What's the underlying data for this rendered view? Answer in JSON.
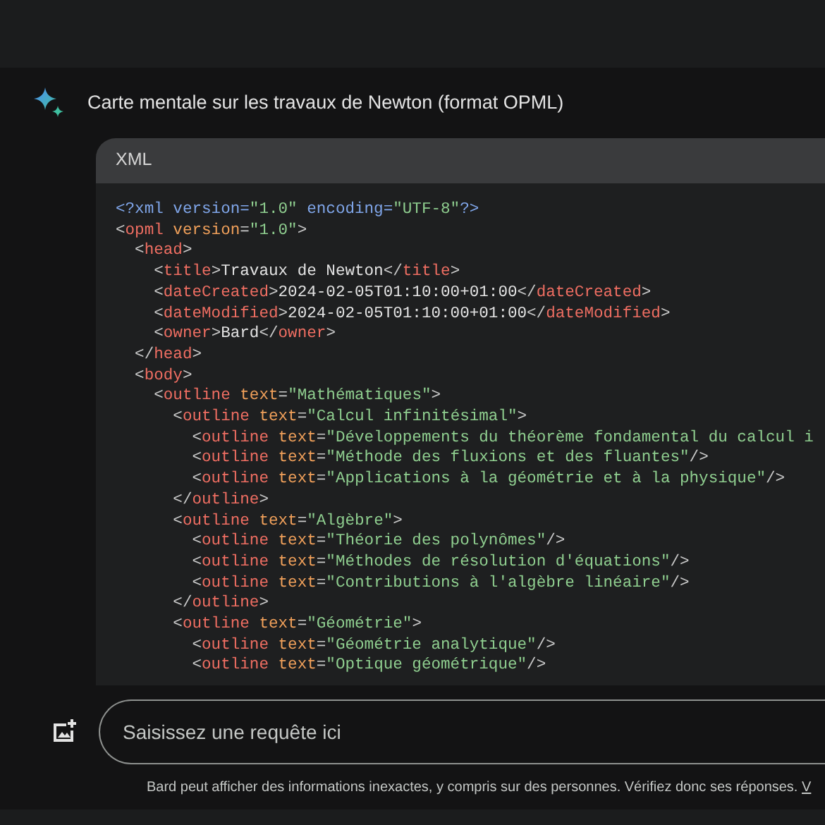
{
  "response": {
    "title": "Carte mentale sur les travaux de Newton (format OPML)",
    "code_block": {
      "language": "XML",
      "lines": [
        [
          {
            "kind": "decl",
            "text": "<?xml version="
          },
          {
            "kind": "string",
            "text": "\"1.0\""
          },
          {
            "kind": "decl",
            "text": " encoding="
          },
          {
            "kind": "string",
            "text": "\"UTF-8\""
          },
          {
            "kind": "decl",
            "text": "?>"
          }
        ],
        [
          {
            "kind": "punct",
            "text": "<"
          },
          {
            "kind": "tag",
            "text": "opml"
          },
          {
            "kind": "attr",
            "text": " version"
          },
          {
            "kind": "punct",
            "text": "="
          },
          {
            "kind": "string",
            "text": "\"1.0\""
          },
          {
            "kind": "punct",
            "text": ">"
          }
        ],
        [
          {
            "kind": "punct",
            "text": "  <"
          },
          {
            "kind": "tag",
            "text": "head"
          },
          {
            "kind": "punct",
            "text": ">"
          }
        ],
        [
          {
            "kind": "punct",
            "text": "    <"
          },
          {
            "kind": "tag",
            "text": "title"
          },
          {
            "kind": "punct",
            "text": ">"
          },
          {
            "kind": "text",
            "text": "Travaux de Newton"
          },
          {
            "kind": "punct",
            "text": "</"
          },
          {
            "kind": "tag",
            "text": "title"
          },
          {
            "kind": "punct",
            "text": ">"
          }
        ],
        [
          {
            "kind": "punct",
            "text": "    <"
          },
          {
            "kind": "tag",
            "text": "dateCreated"
          },
          {
            "kind": "punct",
            "text": ">"
          },
          {
            "kind": "text",
            "text": "2024-02-05T01:10:00+01:00"
          },
          {
            "kind": "punct",
            "text": "</"
          },
          {
            "kind": "tag",
            "text": "dateCreated"
          },
          {
            "kind": "punct",
            "text": ">"
          }
        ],
        [
          {
            "kind": "punct",
            "text": "    <"
          },
          {
            "kind": "tag",
            "text": "dateModified"
          },
          {
            "kind": "punct",
            "text": ">"
          },
          {
            "kind": "text",
            "text": "2024-02-05T01:10:00+01:00"
          },
          {
            "kind": "punct",
            "text": "</"
          },
          {
            "kind": "tag",
            "text": "dateModified"
          },
          {
            "kind": "punct",
            "text": ">"
          }
        ],
        [
          {
            "kind": "punct",
            "text": "    <"
          },
          {
            "kind": "tag",
            "text": "owner"
          },
          {
            "kind": "punct",
            "text": ">"
          },
          {
            "kind": "text",
            "text": "Bard"
          },
          {
            "kind": "punct",
            "text": "</"
          },
          {
            "kind": "tag",
            "text": "owner"
          },
          {
            "kind": "punct",
            "text": ">"
          }
        ],
        [
          {
            "kind": "punct",
            "text": "  </"
          },
          {
            "kind": "tag",
            "text": "head"
          },
          {
            "kind": "punct",
            "text": ">"
          }
        ],
        [
          {
            "kind": "punct",
            "text": "  <"
          },
          {
            "kind": "tag",
            "text": "body"
          },
          {
            "kind": "punct",
            "text": ">"
          }
        ],
        [
          {
            "kind": "punct",
            "text": "    <"
          },
          {
            "kind": "tag",
            "text": "outline"
          },
          {
            "kind": "attr",
            "text": " text"
          },
          {
            "kind": "punct",
            "text": "="
          },
          {
            "kind": "string",
            "text": "\"Mathématiques\""
          },
          {
            "kind": "punct",
            "text": ">"
          }
        ],
        [
          {
            "kind": "punct",
            "text": "      <"
          },
          {
            "kind": "tag",
            "text": "outline"
          },
          {
            "kind": "attr",
            "text": " text"
          },
          {
            "kind": "punct",
            "text": "="
          },
          {
            "kind": "string",
            "text": "\"Calcul infinitésimal\""
          },
          {
            "kind": "punct",
            "text": ">"
          }
        ],
        [
          {
            "kind": "punct",
            "text": "        <"
          },
          {
            "kind": "tag",
            "text": "outline"
          },
          {
            "kind": "attr",
            "text": " text"
          },
          {
            "kind": "punct",
            "text": "="
          },
          {
            "kind": "string",
            "text": "\"Développements du théorème fondamental du calcul i"
          }
        ],
        [
          {
            "kind": "punct",
            "text": "        <"
          },
          {
            "kind": "tag",
            "text": "outline"
          },
          {
            "kind": "attr",
            "text": " text"
          },
          {
            "kind": "punct",
            "text": "="
          },
          {
            "kind": "string",
            "text": "\"Méthode des fluxions et des fluantes\""
          },
          {
            "kind": "punct",
            "text": "/>"
          }
        ],
        [
          {
            "kind": "punct",
            "text": "        <"
          },
          {
            "kind": "tag",
            "text": "outline"
          },
          {
            "kind": "attr",
            "text": " text"
          },
          {
            "kind": "punct",
            "text": "="
          },
          {
            "kind": "string",
            "text": "\"Applications à la géométrie et à la physique\""
          },
          {
            "kind": "punct",
            "text": "/>"
          }
        ],
        [
          {
            "kind": "punct",
            "text": "      </"
          },
          {
            "kind": "tag",
            "text": "outline"
          },
          {
            "kind": "punct",
            "text": ">"
          }
        ],
        [
          {
            "kind": "punct",
            "text": "      <"
          },
          {
            "kind": "tag",
            "text": "outline"
          },
          {
            "kind": "attr",
            "text": " text"
          },
          {
            "kind": "punct",
            "text": "="
          },
          {
            "kind": "string",
            "text": "\"Algèbre\""
          },
          {
            "kind": "punct",
            "text": ">"
          }
        ],
        [
          {
            "kind": "punct",
            "text": "        <"
          },
          {
            "kind": "tag",
            "text": "outline"
          },
          {
            "kind": "attr",
            "text": " text"
          },
          {
            "kind": "punct",
            "text": "="
          },
          {
            "kind": "string",
            "text": "\"Théorie des polynômes\""
          },
          {
            "kind": "punct",
            "text": "/>"
          }
        ],
        [
          {
            "kind": "punct",
            "text": "        <"
          },
          {
            "kind": "tag",
            "text": "outline"
          },
          {
            "kind": "attr",
            "text": " text"
          },
          {
            "kind": "punct",
            "text": "="
          },
          {
            "kind": "string",
            "text": "\"Méthodes de résolution d'équations\""
          },
          {
            "kind": "punct",
            "text": "/>"
          }
        ],
        [
          {
            "kind": "punct",
            "text": "        <"
          },
          {
            "kind": "tag",
            "text": "outline"
          },
          {
            "kind": "attr",
            "text": " text"
          },
          {
            "kind": "punct",
            "text": "="
          },
          {
            "kind": "string",
            "text": "\"Contributions à l'algèbre linéaire\""
          },
          {
            "kind": "punct",
            "text": "/>"
          }
        ],
        [
          {
            "kind": "punct",
            "text": "      </"
          },
          {
            "kind": "tag",
            "text": "outline"
          },
          {
            "kind": "punct",
            "text": ">"
          }
        ],
        [
          {
            "kind": "punct",
            "text": "      <"
          },
          {
            "kind": "tag",
            "text": "outline"
          },
          {
            "kind": "attr",
            "text": " text"
          },
          {
            "kind": "punct",
            "text": "="
          },
          {
            "kind": "string",
            "text": "\"Géométrie\""
          },
          {
            "kind": "punct",
            "text": ">"
          }
        ],
        [
          {
            "kind": "punct",
            "text": "        <"
          },
          {
            "kind": "tag",
            "text": "outline"
          },
          {
            "kind": "attr",
            "text": " text"
          },
          {
            "kind": "punct",
            "text": "="
          },
          {
            "kind": "string",
            "text": "\"Géométrie analytique\""
          },
          {
            "kind": "punct",
            "text": "/>"
          }
        ],
        [
          {
            "kind": "punct",
            "text": "        <"
          },
          {
            "kind": "tag",
            "text": "outline"
          },
          {
            "kind": "attr",
            "text": " text"
          },
          {
            "kind": "punct",
            "text": "="
          },
          {
            "kind": "string",
            "text": "\"Optique géométrique\""
          },
          {
            "kind": "punct",
            "text": "/>"
          }
        ]
      ]
    }
  },
  "prompt": {
    "placeholder": "Saisissez une requête ici"
  },
  "disclaimer": {
    "text": "Bard peut afficher des informations inexactes, y compris sur des personnes. Vérifiez donc ses réponses.",
    "link": "V"
  }
}
